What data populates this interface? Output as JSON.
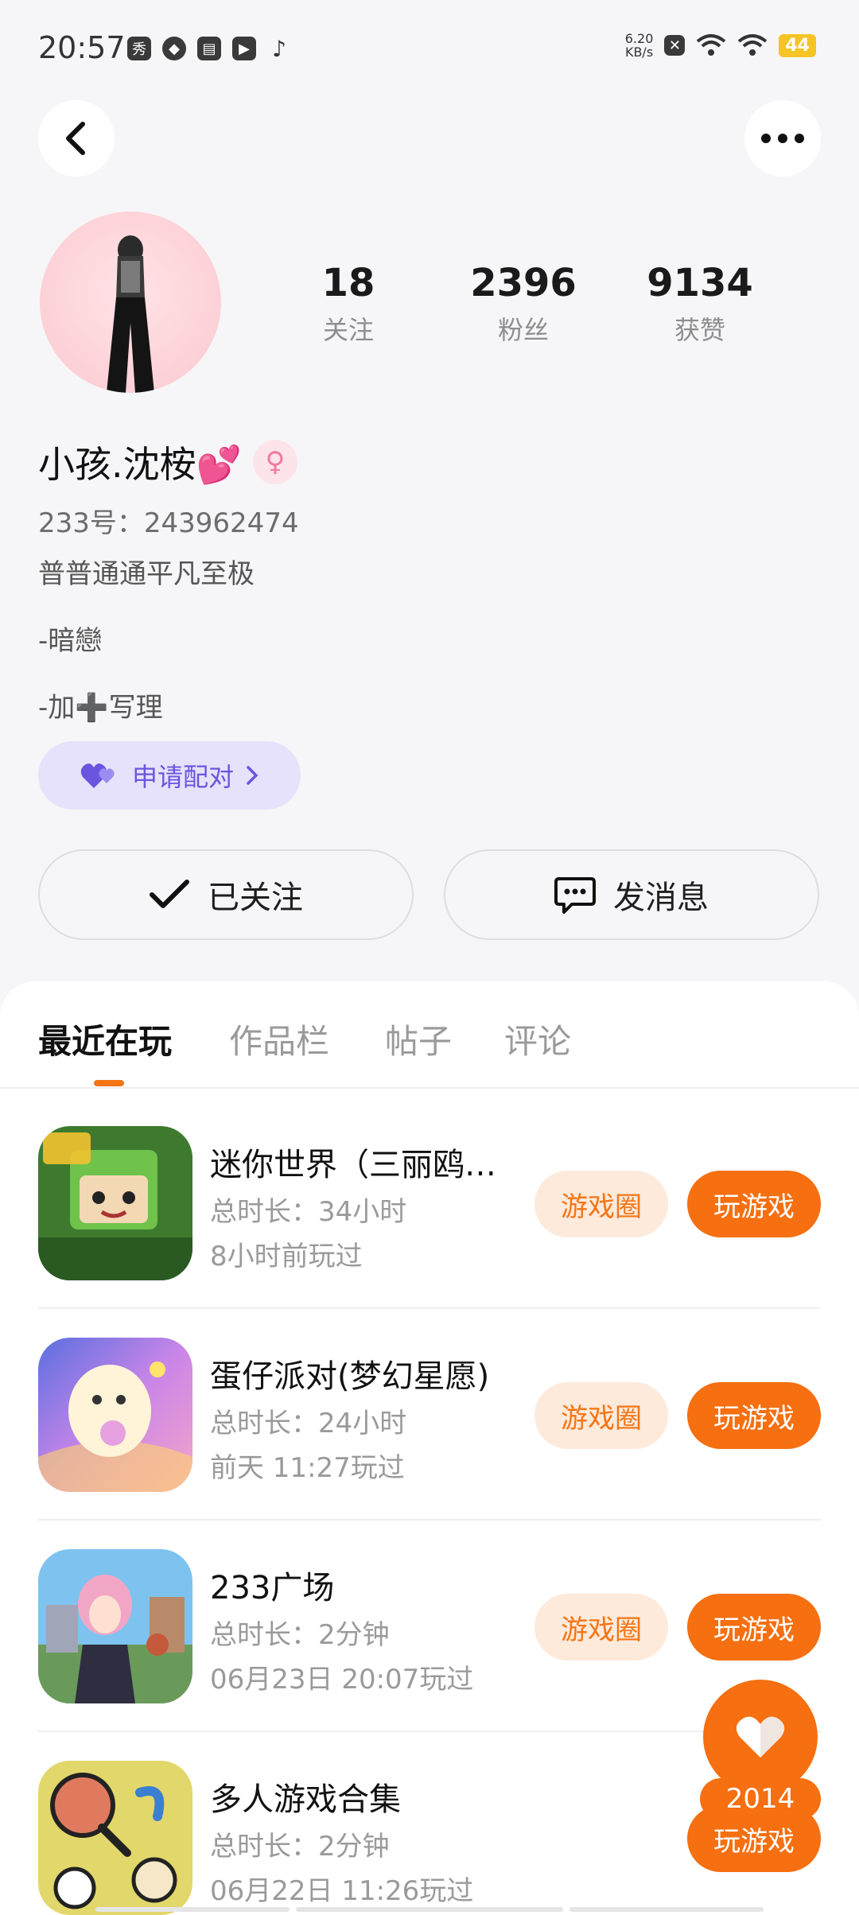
{
  "status": {
    "time": "20:57",
    "netspeed_value": "6.20",
    "netspeed_unit": "KB/s",
    "battery": "44",
    "notif_icon_1": "秀"
  },
  "profile": {
    "nickname": "小孩.沈桉💕",
    "uid": "233号：243962474",
    "bio_lines": [
      "普普通通平凡至极",
      "-暗戀",
      "-加➕写理"
    ],
    "pair_label": "申请配对",
    "stats": [
      {
        "value": "18",
        "label": "关注"
      },
      {
        "value": "2396",
        "label": "粉丝"
      },
      {
        "value": "9134",
        "label": "获赞"
      }
    ],
    "follow_label": "已关注",
    "message_label": "发消息"
  },
  "tabs": [
    "最近在玩",
    "作品栏",
    "帖子",
    "评论"
  ],
  "games": [
    {
      "name": "迷你世界（三丽鸥联动）",
      "duration": "总时长：34小时",
      "last": "8小时前玩过",
      "circle": "游戏圈",
      "play": "玩游戏"
    },
    {
      "name": "蛋仔派对(梦幻星愿)",
      "duration": "总时长：24小时",
      "last": "前天 11:27玩过",
      "circle": "游戏圈",
      "play": "玩游戏"
    },
    {
      "name": "233广场",
      "duration": "总时长：2分钟",
      "last": "06月23日 20:07玩过",
      "circle": "游戏圈",
      "play": "玩游戏"
    },
    {
      "name": "多人游戏合集",
      "duration": "总时长：2分钟",
      "last": "06月22日 11:26玩过",
      "circle": "",
      "play": "玩游戏"
    }
  ],
  "fab": {
    "count": "2014"
  },
  "colors": {
    "accent": "#f66f10",
    "pair": "#6a55e0",
    "gender": "#f27a9a"
  }
}
